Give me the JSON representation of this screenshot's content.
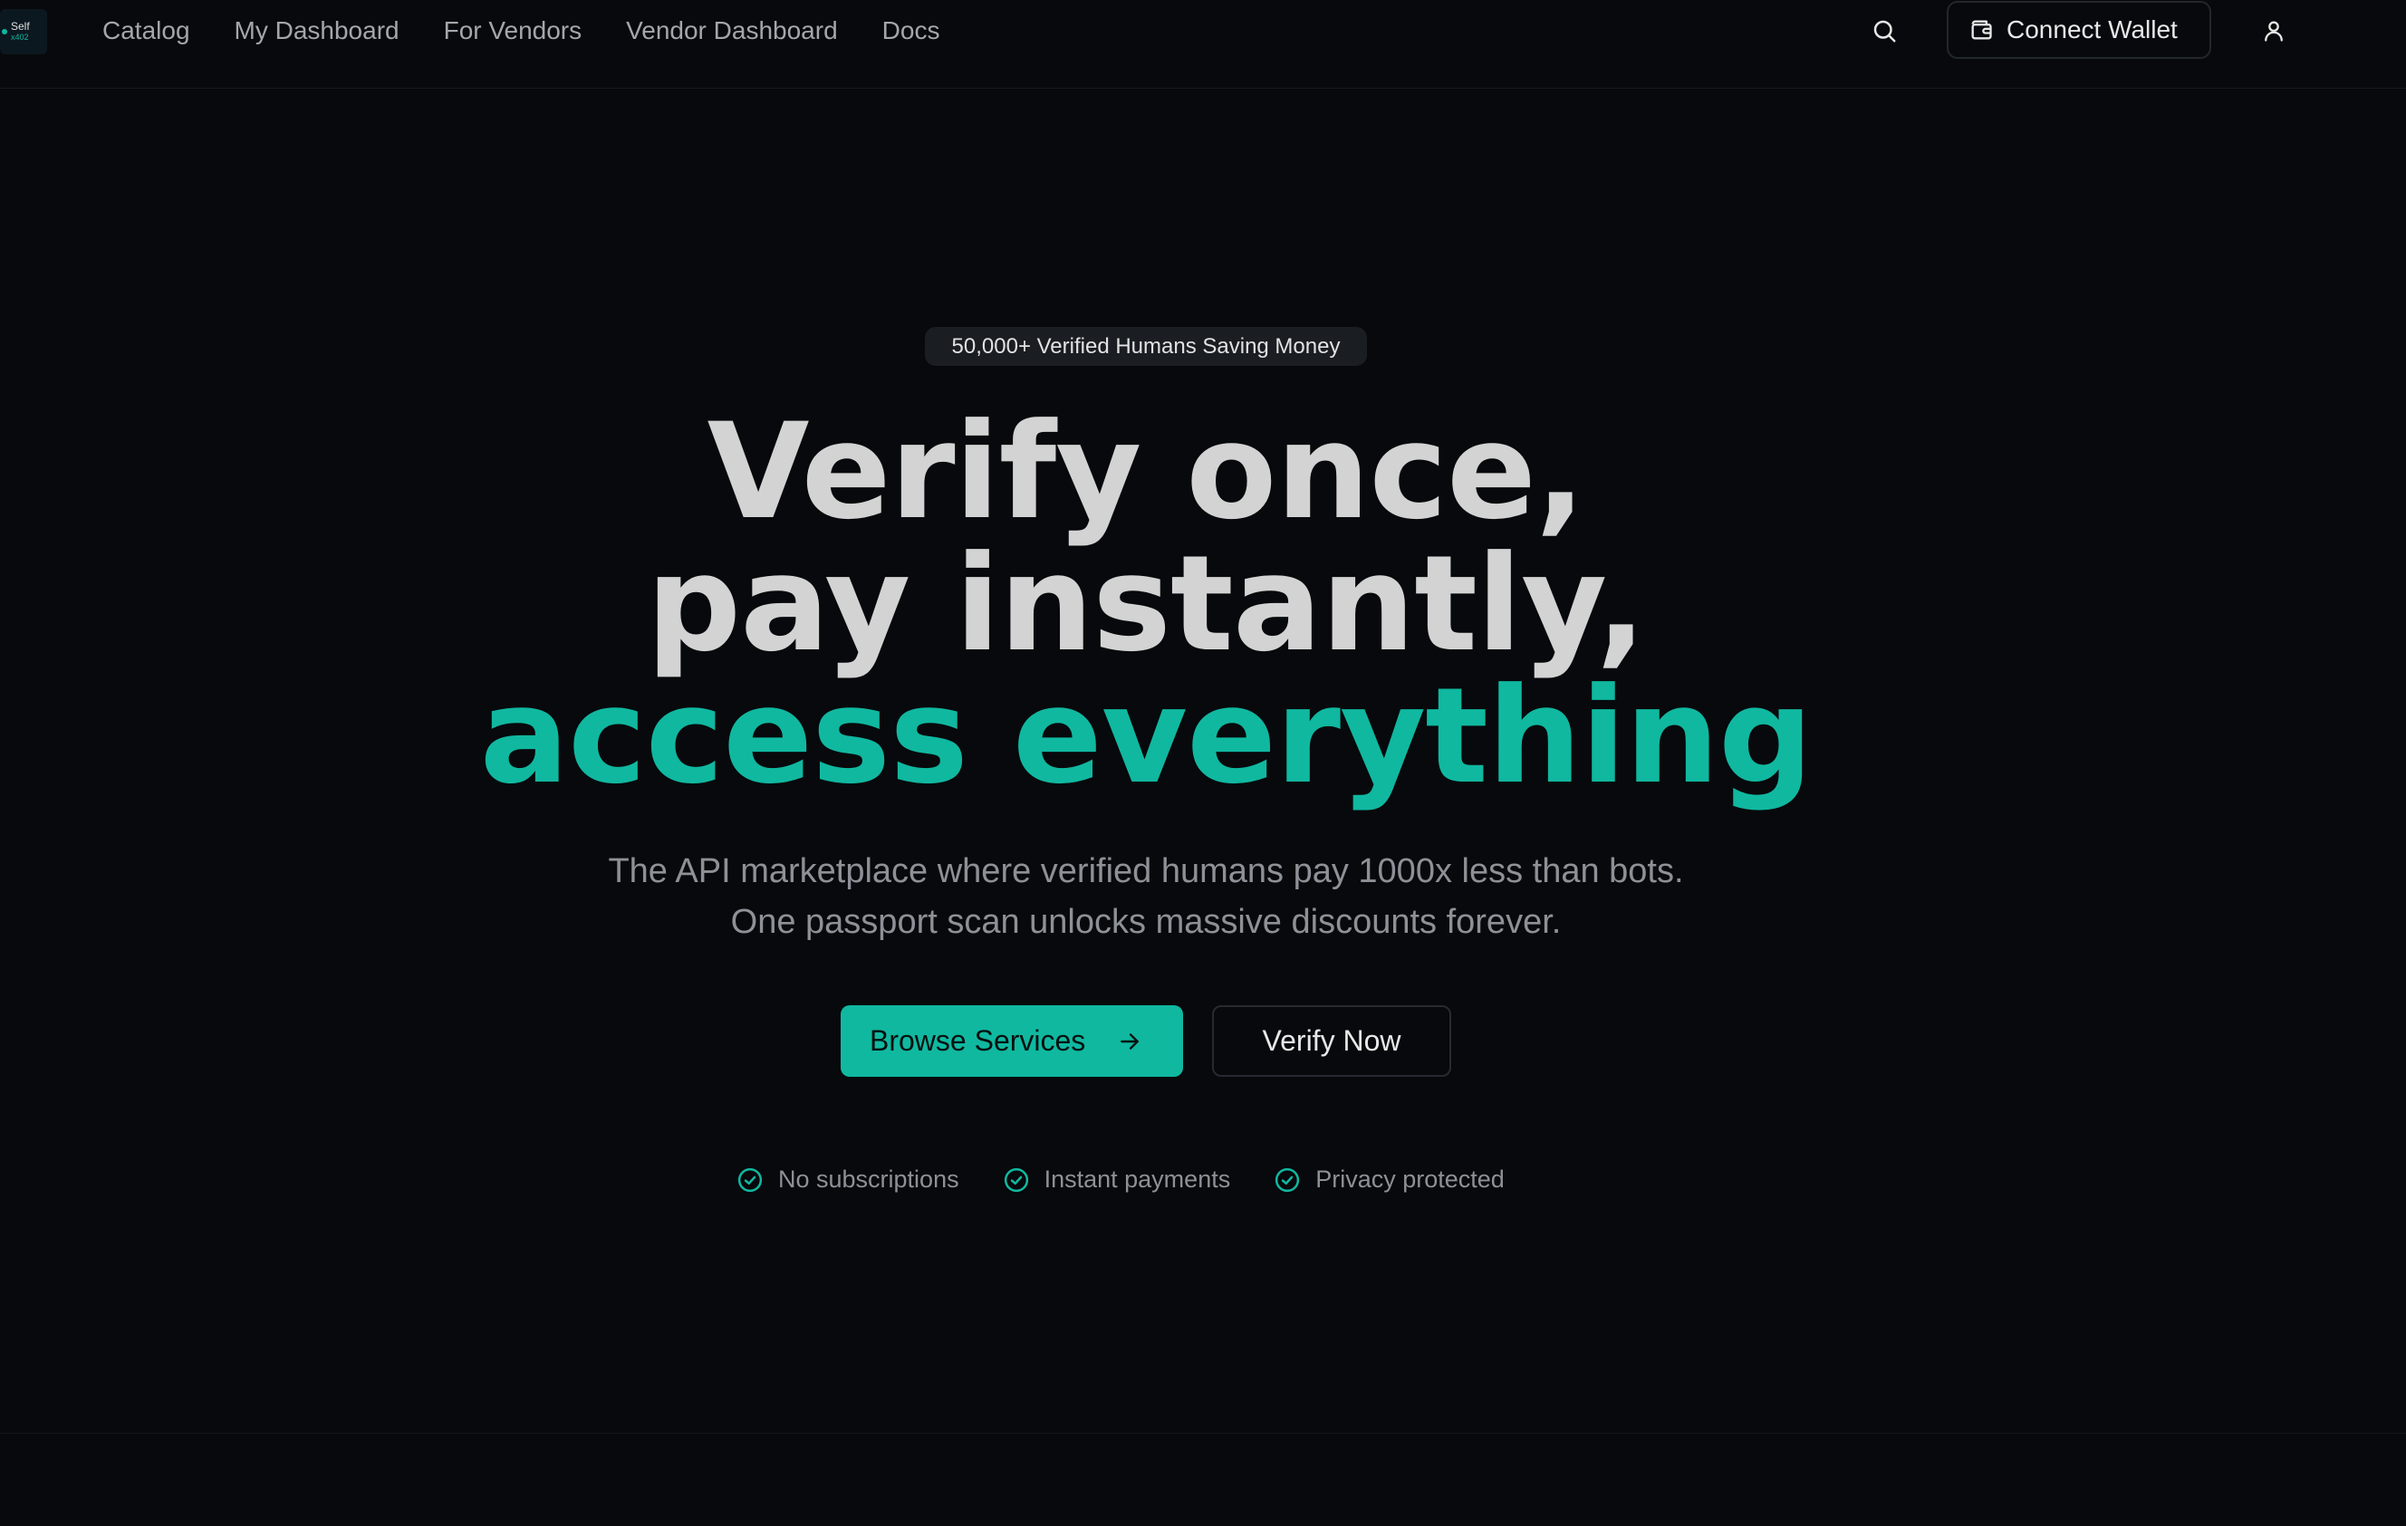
{
  "brand": {
    "logo_line1": "Self",
    "logo_line2": "x402"
  },
  "nav": {
    "links": [
      "Catalog",
      "My Dashboard",
      "For Vendors",
      "Vendor Dashboard",
      "Docs"
    ],
    "search_icon": "search-icon",
    "wallet_label": "Connect Wallet",
    "wallet_icon": "wallet-icon",
    "user_icon": "user-icon"
  },
  "hero": {
    "badge": "50,000+ Verified Humans Saving Money",
    "headline_line1": "Verify once,",
    "headline_line2": "pay instantly,",
    "headline_line3": "access everything",
    "subtitle_line1": "The API marketplace where verified humans pay 1000x less than bots.",
    "subtitle_line2": "One passport scan unlocks massive discounts forever.",
    "primary_cta": "Browse Services",
    "secondary_cta": "Verify Now",
    "features": [
      "No subscriptions",
      "Instant payments",
      "Privacy protected"
    ]
  },
  "colors": {
    "background": "#07090c",
    "accent": "#10b8a0",
    "headline": "#d3d3d3",
    "muted_text": "#8d9197"
  }
}
